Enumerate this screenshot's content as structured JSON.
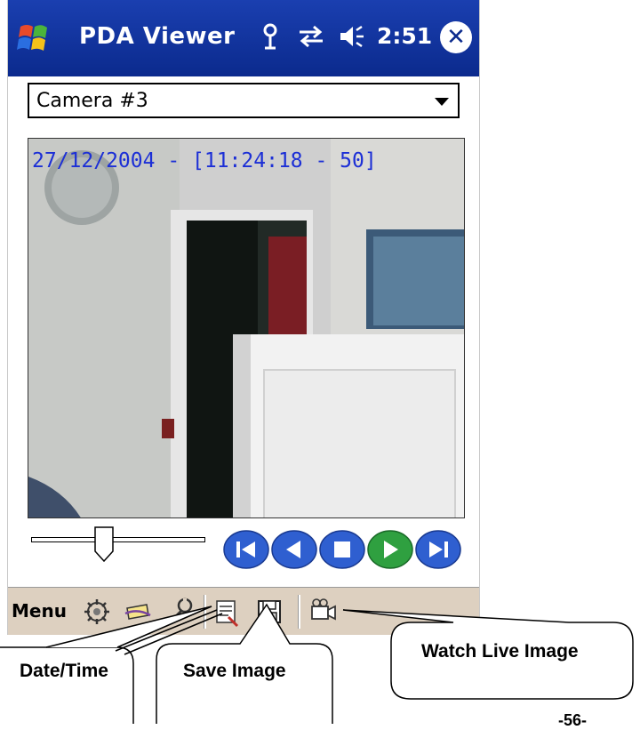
{
  "window": {
    "title": "PDA Viewer",
    "clock": "2:51"
  },
  "camera": {
    "selected": "Camera #3"
  },
  "video": {
    "timestamp": "27/12/2004 - [11:24:18 - 50]"
  },
  "slider": {
    "position_fraction": 0.42
  },
  "playback": {
    "buttons": [
      {
        "name": "first",
        "icon": "skip-to-start-icon",
        "color": "#2f5fd0"
      },
      {
        "name": "previous",
        "icon": "previous-icon",
        "color": "#2f5fd0"
      },
      {
        "name": "stop",
        "icon": "stop-icon",
        "color": "#2f5fd0"
      },
      {
        "name": "play",
        "icon": "play-icon",
        "color": "#2fa040"
      },
      {
        "name": "last",
        "icon": "skip-to-end-icon",
        "color": "#2f5fd0"
      }
    ]
  },
  "commandbar": {
    "menu_label": "Menu",
    "icons": [
      "settings-icon",
      "date-time-icon",
      "tools-icon",
      "date-time-icon",
      "save-icon",
      "live-camera-icon"
    ]
  },
  "callouts": {
    "date_time": "Date/Time",
    "save_image": "Save Image",
    "watch_live": "Watch Live Image"
  },
  "page_number": "-56-",
  "colors": {
    "titlebar": "#0b2a8d",
    "timestamp": "#1c2fd6",
    "commandbar": "#ddd0c0"
  }
}
